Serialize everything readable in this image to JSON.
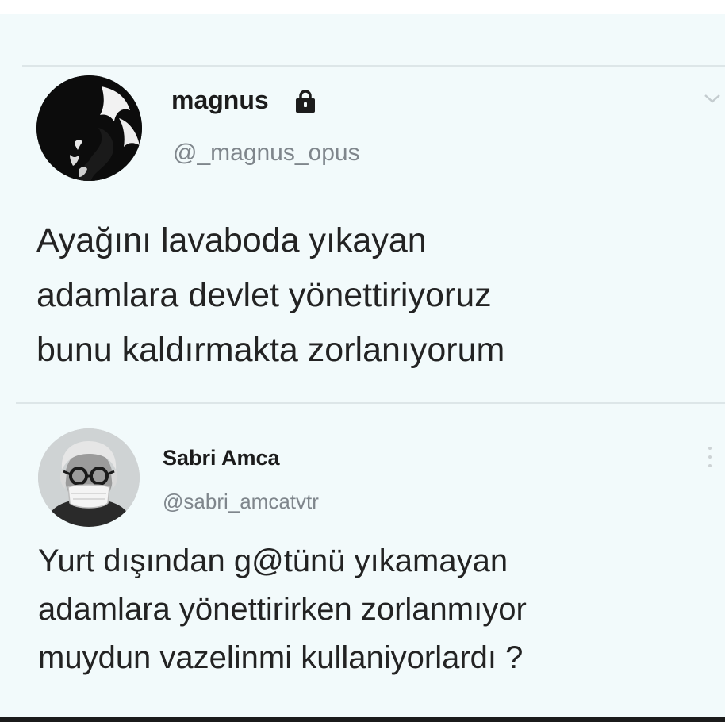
{
  "tweet1": {
    "display_name": "magnus",
    "handle": "@_magnus_opus",
    "lines": [
      "Ayağını lavaboda yıkayan",
      "adamlara devlet yönettiriyoruz",
      "bunu kaldırmakta zorlanıyorum"
    ],
    "protected_icon": "lock-icon",
    "menu_icon": "chevron-down-icon"
  },
  "tweet2": {
    "display_name": "Sabri Amca",
    "handle": "@sabri_amcatvtr",
    "lines": [
      "Yurt dışından g@tünü yıkamayan",
      "adamlara yönettirirken zorlanmıyor",
      "muydun vazelinmi kullaniyorlardı ?"
    ],
    "menu_icon": "more-vertical-icon"
  }
}
